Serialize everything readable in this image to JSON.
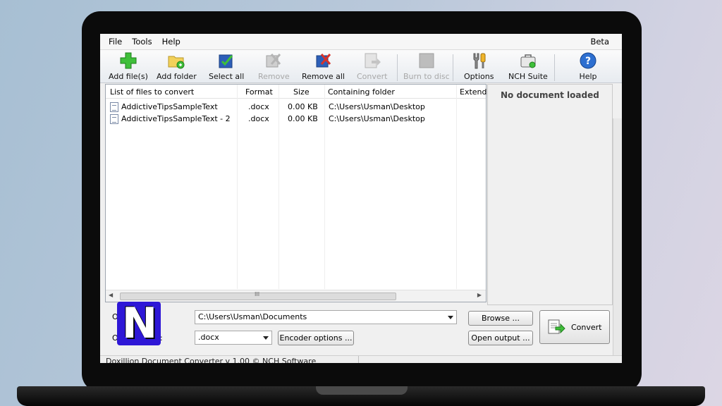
{
  "menu": {
    "items": [
      "File",
      "Tools",
      "Help"
    ],
    "beta": "Beta"
  },
  "toolbar": {
    "add_files": "Add file(s)",
    "add_folder": "Add folder",
    "select_all": "Select all",
    "remove": "Remove",
    "remove_all": "Remove all",
    "convert": "Convert",
    "burn": "Burn to disc",
    "options": "Options",
    "nch_suite": "NCH Suite",
    "help": "Help"
  },
  "file_list": {
    "columns": [
      "List of files to convert",
      "Format",
      "Size",
      "Containing folder",
      "Extende"
    ],
    "rows": [
      {
        "name": "AddictiveTipsSampleText",
        "format": ".docx",
        "size": "0.00 KB",
        "folder": "C:\\Users\\Usman\\Desktop"
      },
      {
        "name": "AddictiveTipsSampleText - 2",
        "format": ".docx",
        "size": "0.00 KB",
        "folder": "C:\\Users\\Usman\\Desktop"
      }
    ],
    "scroll_grip": "III"
  },
  "preview": {
    "message": "No document loaded"
  },
  "output": {
    "folder_label": "O",
    "folder_value": "C:\\Users\\Usman\\Documents",
    "format_label_start": "O",
    "format_label_end": ":",
    "format_value": ".docx",
    "browse": "Browse ...",
    "encoder_options": "Encoder options ...",
    "open_output": "Open output ...",
    "convert": "Convert"
  },
  "status": {
    "text": "Doxillion Document Converter v 1.00 © NCH Software"
  },
  "logo": {
    "letter": "N",
    "color": "#2e17d6"
  }
}
